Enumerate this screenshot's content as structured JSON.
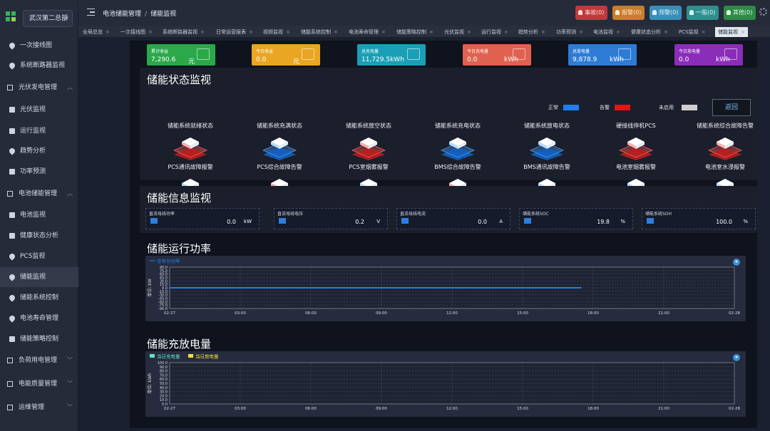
{
  "site_select": "武汉第二总部",
  "breadcrumb": {
    "parent": "电池储能管理",
    "current": "储能监视"
  },
  "sidebar": [
    {
      "label": "一次接线图",
      "icon": "map-pin-icon",
      "type": "sub"
    },
    {
      "label": "系统断路器监视",
      "icon": "map-pin-icon",
      "type": "sub"
    },
    {
      "label": "光伏发电管理",
      "icon": "solar-group-icon",
      "type": "group"
    },
    {
      "label": "光伏监视",
      "icon": "solar-icon",
      "type": "sub"
    },
    {
      "label": "运行监视",
      "icon": "monitor-icon",
      "type": "sub"
    },
    {
      "label": "趋势分析",
      "icon": "map-pin-icon",
      "type": "sub"
    },
    {
      "label": "功率预测",
      "icon": "forecast-icon",
      "type": "sub"
    },
    {
      "label": "电池储能管理",
      "icon": "battery-group-icon",
      "type": "group"
    },
    {
      "label": "电池监视",
      "icon": "battery-icon",
      "type": "sub"
    },
    {
      "label": "健康状态分析",
      "icon": "health-icon",
      "type": "sub"
    },
    {
      "label": "PCS监视",
      "icon": "map-pin-icon",
      "type": "sub"
    },
    {
      "label": "储能监视",
      "icon": "map-pin-icon",
      "type": "sub"
    },
    {
      "label": "储能系统控制",
      "icon": "map-pin-icon",
      "type": "sub"
    },
    {
      "label": "电池寿命管理",
      "icon": "map-pin-icon",
      "type": "sub"
    },
    {
      "label": "储能策略控制",
      "icon": "strategy-icon",
      "type": "sub"
    },
    {
      "label": "负荷用电管理",
      "icon": "load-group-icon",
      "type": "group"
    },
    {
      "label": "电能质量管理",
      "icon": "quality-group-icon",
      "type": "group"
    },
    {
      "label": "运维管理",
      "icon": "ops-group-icon",
      "type": "group"
    }
  ],
  "alarms": [
    {
      "label": "事故(0)",
      "bg": "#c0393b",
      "color": "#fbe0e0"
    },
    {
      "label": "报警(0)",
      "bg": "#c97d2e",
      "color": "#ffe9d0"
    },
    {
      "label": "预警(0)",
      "bg": "#3a8fb8",
      "color": "#dff2ff"
    },
    {
      "label": "一般(0)",
      "bg": "#2f8f8f",
      "color": "#dcfbfb"
    },
    {
      "label": "其他(0)",
      "bg": "#2e8a45",
      "color": "#dffbe5"
    }
  ],
  "tabs": [
    "全局总览",
    "一次接线图",
    "系统断路器监视",
    "日常运营报表",
    "视频监视",
    "储能系统控制",
    "电池寿命管理",
    "储能策略控制",
    "光伏监视",
    "运行监视",
    "趋势分析",
    "功率预测",
    "电池监视",
    "健康状态分析",
    "PCS监视",
    "储能监视"
  ],
  "active_tab": "储能监视",
  "kpis": [
    {
      "label": "累计收益",
      "value": "7,290.6",
      "unit": "元",
      "bg": "#2aa84a"
    },
    {
      "label": "今日收益",
      "value": "0.0",
      "unit": "元",
      "bg": "#e9a622"
    },
    {
      "label": "总充电量",
      "value": "11,729.5kWh",
      "unit": "",
      "bg": "#1a9fb6"
    },
    {
      "label": "今日充电量",
      "value": "0.0",
      "unit": "kWh",
      "bg": "#e0614f"
    },
    {
      "label": "总放电量",
      "value": "9,878.9",
      "unit": "kWh",
      "bg": "#2e7bd6"
    },
    {
      "label": "今日放电量",
      "value": "0.0",
      "unit": "kWh",
      "bg": "#8a2db8"
    }
  ],
  "status_panel": {
    "title": "储能状态监视",
    "legend": [
      {
        "label": "正常",
        "color": "#1e7df0"
      },
      {
        "label": "告警",
        "color": "#e01515"
      },
      {
        "label": "未启用",
        "color": "#cfcfcf"
      }
    ],
    "return_label": "返回",
    "items": [
      {
        "label": "储能系统就绪状态",
        "state": "alarm"
      },
      {
        "label": "储能系统充满状态",
        "state": "normal"
      },
      {
        "label": "储能系统放空状态",
        "state": "alarm"
      },
      {
        "label": "储能系统充电状态",
        "state": "normal"
      },
      {
        "label": "储能系统放电状态",
        "state": "normal"
      },
      {
        "label": "硬接线停机PCS",
        "state": "alarm"
      },
      {
        "label": "储能系统综合故障告警",
        "state": "alarm"
      },
      {
        "label": "PCS通讯故障报警",
        "state": "normal"
      },
      {
        "label": "PCS综合故障告警",
        "state": "alarm"
      },
      {
        "label": "PCS室烟雾报警",
        "state": "normal"
      },
      {
        "label": "BMS综合故障告警",
        "state": "alarm"
      },
      {
        "label": "BMS通讯故障告警",
        "state": "normal"
      },
      {
        "label": "电池室烟雾报警",
        "state": "normal"
      },
      {
        "label": "电池室水浸报警",
        "state": "normal"
      }
    ]
  },
  "info_panel": {
    "title": "储能信息监视",
    "items": [
      {
        "label": "直流母线功率",
        "value": "0.0",
        "unit": "kW"
      },
      {
        "label": "直流母线电压",
        "value": "0.2",
        "unit": "V"
      },
      {
        "label": "直流母线电流",
        "value": "0.0",
        "unit": "A"
      },
      {
        "label": "储能系统SOC",
        "value": "19.8",
        "unit": "%"
      },
      {
        "label": "储能系统SOH",
        "value": "100.0",
        "unit": "%"
      }
    ]
  },
  "power_chart": {
    "title": "储能运行功率",
    "chart_data": {
      "type": "line",
      "series": [
        {
          "name": "总有功功率",
          "color": "#1e7df0",
          "values": [
            [
              0,
              0
            ],
            [
              17.5,
              0
            ]
          ]
        }
      ],
      "ylabel": "单位: kW",
      "ylim": [
        -90,
        90
      ],
      "yticks": [
        "90.0",
        "75.0",
        "60.0",
        "45.0",
        "30.0",
        "15.0",
        "0.0",
        "-15.0",
        "-30.0",
        "-45.0",
        "-60.0",
        "-75.0",
        "-90.0"
      ],
      "yvals": [
        90,
        75,
        60,
        45,
        30,
        15,
        0,
        -15,
        -30,
        -45,
        -60,
        -75,
        -90
      ],
      "xticks": [
        "02-27",
        "03:00",
        "06:00",
        "09:00",
        "12:00",
        "15:00",
        "18:00",
        "21:00",
        "02-28"
      ],
      "xvals": [
        0,
        3,
        6,
        9,
        12,
        15,
        18,
        21,
        24
      ]
    }
  },
  "energy_chart": {
    "title": "储能充放电量",
    "chart_data": {
      "type": "bar",
      "series": [
        {
          "name": "当日充电量",
          "color": "#5ee6c9",
          "values": []
        },
        {
          "name": "当日放电量",
          "color": "#f2e23a",
          "values": []
        }
      ],
      "ylabel": "单位: kWh",
      "ylim": [
        0,
        100
      ],
      "yticks": [
        "100.0",
        "90.0",
        "80.0",
        "70.0",
        "60.0",
        "50.0",
        "40.0",
        "30.0",
        "20.0",
        "10.0",
        "0.0"
      ],
      "yvals": [
        100,
        90,
        80,
        70,
        60,
        50,
        40,
        30,
        20,
        10,
        0
      ],
      "xticks": [
        "02-27",
        "03:00",
        "06:00",
        "09:00",
        "12:00",
        "15:00",
        "18:00",
        "21:00",
        "02-28"
      ],
      "xvals": [
        0,
        3,
        6,
        9,
        12,
        15,
        18,
        21,
        24
      ]
    }
  }
}
